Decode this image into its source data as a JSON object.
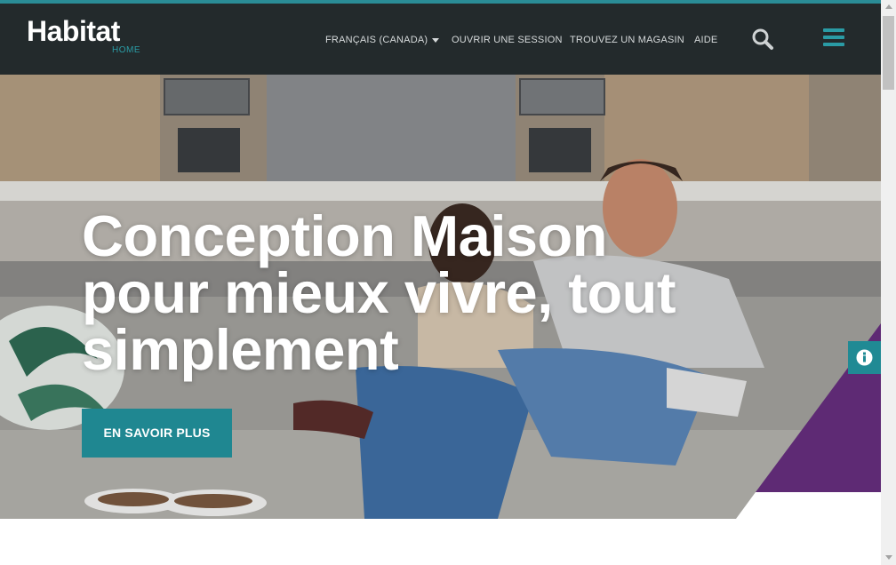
{
  "brand": {
    "name": "Habitat",
    "sub": "HOME",
    "accent": "#2a8c96",
    "purple": "#5e2a74"
  },
  "nav": {
    "language": "FRANÇAIS (CANADA)",
    "login": "OUVRIR UNE SESSION",
    "store_finder": "TROUVEZ UN MAGASIN",
    "help": "AIDE"
  },
  "icons": {
    "search": "search-icon",
    "menu": "hamburger-menu-icon",
    "info": "info-icon",
    "caret": "caret-down-icon"
  },
  "hero": {
    "title_lines": [
      "Conception Maison",
      "pour mieux vivre, tout",
      "simplement"
    ],
    "cta": "EN SAVOIR PLUS",
    "slides": {
      "count": 3,
      "active": 1
    }
  }
}
